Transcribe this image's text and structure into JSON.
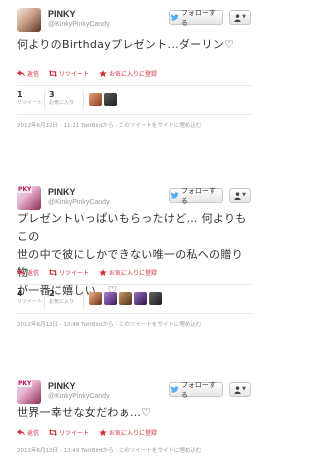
{
  "tweets": [
    {
      "name": "PINKY",
      "handle": "@KinkyPinkyCandy",
      "follow_label": "フォローする",
      "text": "何よりのBirthdayプレゼント...ダーリン♡",
      "actions": {
        "reply": "返信",
        "retweet": "リツイート",
        "favorite": "お気に入りに登録"
      },
      "retweets": {
        "count": "1",
        "label": "リツイート"
      },
      "favorites": {
        "count": "3",
        "label": "お気に入り"
      },
      "timestamp": "2012年6月12日 - 11:11 TwitBirdから · このツイートをサイトに埋め込む"
    },
    {
      "name": "PINKY",
      "handle": "@KinkyPinkyCandy",
      "follow_label": "フォローする",
      "text_lines": [
        "プレゼントいっぱいもらったけど… 何よりもこの",
        "世の中で彼にしかできない唯一の私への贈り物",
        "が一番に嬉しい…♡"
      ],
      "actions": {
        "reply": "返信",
        "retweet": "リツイート",
        "favorite": "お気に入りに登録"
      },
      "retweets": {
        "count": "4",
        "label": "リツイート"
      },
      "favorites": {
        "count": "2",
        "label": "お気に入り"
      },
      "timestamp": "2012年6月12日 - 12:48 TwitBirdから · このツイートをサイトに埋め込む"
    },
    {
      "name": "PINKY",
      "handle": "@KinkyPinkyCandy",
      "follow_label": "フォローする",
      "text": "世界一幸せな女だわぁ…♡",
      "actions": {
        "reply": "返信",
        "retweet": "リツイート",
        "favorite": "お気に入りに登録"
      },
      "timestamp": "2012年6月13日 - 12:49 TwitBirdから · このツイートをサイトに埋め込む"
    }
  ],
  "colors": {
    "action": "#d02f3a",
    "bird": "#55acee",
    "muted": "#999999"
  },
  "icons": [
    "twitter-bird-icon",
    "person-icon",
    "reply-icon",
    "retweet-icon",
    "star-icon"
  ]
}
